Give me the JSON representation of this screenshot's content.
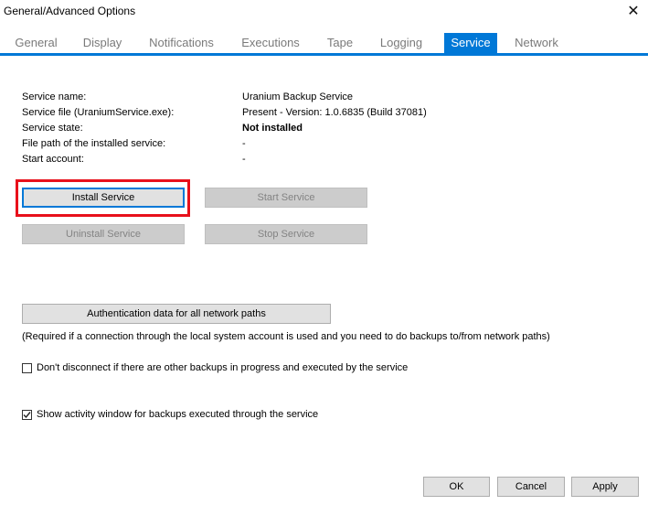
{
  "window": {
    "title": "General/Advanced Options",
    "close_glyph": "✕"
  },
  "tabs": [
    {
      "label": "General",
      "active": false
    },
    {
      "label": "Display",
      "active": false
    },
    {
      "label": "Notifications",
      "active": false
    },
    {
      "label": "Executions",
      "active": false
    },
    {
      "label": "Tape",
      "active": false
    },
    {
      "label": "Logging",
      "active": false
    },
    {
      "label": "Service",
      "active": true
    },
    {
      "label": "Network",
      "active": false
    }
  ],
  "service_info": {
    "name_label": "Service name:",
    "name_value": "Uranium Backup Service",
    "file_label": "Service file (UraniumService.exe):",
    "file_value": "Present - Version: 1.0.6835 (Build 37081)",
    "state_label": "Service state:",
    "state_value": "Not installed",
    "path_label": "File path of the installed service:",
    "path_value": "-",
    "account_label": "Start account:",
    "account_value": "-"
  },
  "buttons": {
    "install": "Install Service",
    "start": "Start Service",
    "uninstall": "Uninstall Service",
    "stop": "Stop Service",
    "auth": "Authentication data for all network paths",
    "ok": "OK",
    "cancel": "Cancel",
    "apply": "Apply"
  },
  "auth_note": "(Required if a connection through the local system account is used and you need to do backups to/from network paths)",
  "options": {
    "dont_disconnect": {
      "label": "Don't disconnect if there are other backups in progress and executed by the service",
      "checked": false
    },
    "show_activity": {
      "label": "Show activity window for backups executed through the service",
      "checked": true
    }
  },
  "colors": {
    "accent": "#0078d7",
    "highlight": "#e8101b"
  }
}
